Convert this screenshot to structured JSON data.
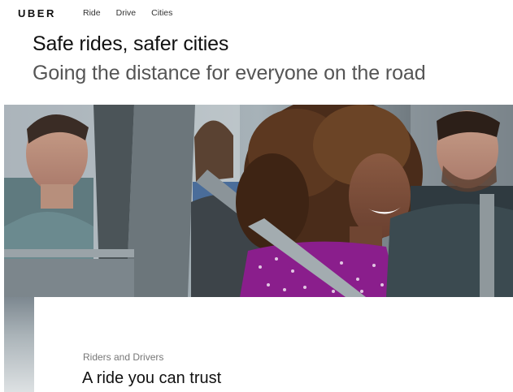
{
  "brand": {
    "logo_text": "UBER"
  },
  "nav": {
    "links": [
      "Ride",
      "Drive",
      "Cities"
    ]
  },
  "hero": {
    "title": "Safe rides, safer cities",
    "subtitle": "Going the distance for everyone on the road"
  },
  "section": {
    "eyebrow": "Riders and Drivers",
    "title": "A ride you can trust"
  },
  "colors": {
    "text_primary": "#111111",
    "text_secondary": "#555555",
    "background": "#ffffff"
  }
}
